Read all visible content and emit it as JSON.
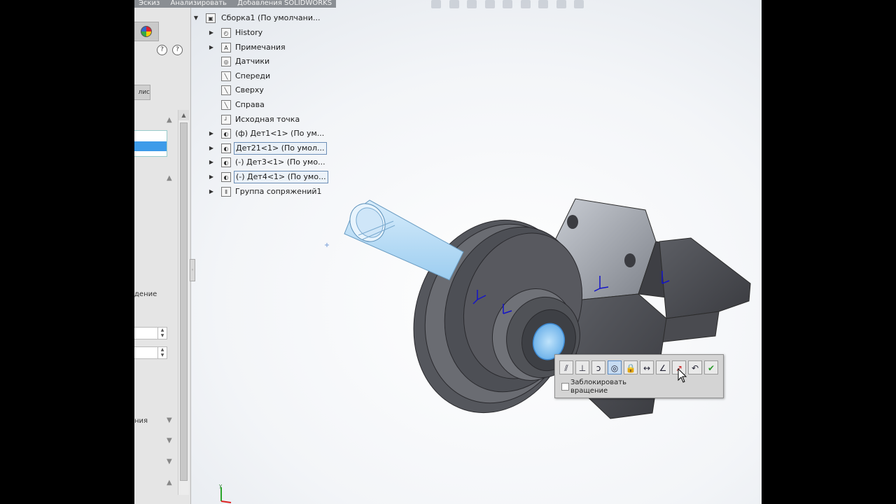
{
  "menu": {
    "items": [
      "Эскиз",
      "Анализировать",
      "Добавления SOLIDWORKS"
    ]
  },
  "left_panel": {
    "help_labels": [
      "?",
      "?"
    ],
    "partial_button": "лис",
    "partial_text_1": "дение",
    "partial_text_2": "ния"
  },
  "tree": {
    "root": "Сборка1  (По умолчани...",
    "nodes": [
      {
        "label": "History",
        "icon": "history-icon",
        "expandable": true,
        "boxed": false
      },
      {
        "label": "Примечания",
        "icon": "annotations-icon",
        "expandable": true,
        "boxed": false
      },
      {
        "label": "Датчики",
        "icon": "sensors-icon",
        "expandable": false,
        "boxed": false
      },
      {
        "label": "Спереди",
        "icon": "plane-icon",
        "expandable": false,
        "boxed": false
      },
      {
        "label": "Сверху",
        "icon": "plane-icon",
        "expandable": false,
        "boxed": false
      },
      {
        "label": "Справа",
        "icon": "plane-icon",
        "expandable": false,
        "boxed": false
      },
      {
        "label": "Исходная точка",
        "icon": "origin-icon",
        "expandable": false,
        "boxed": false
      },
      {
        "label": "(ф) Дет1<1> (По ум...",
        "icon": "part-icon",
        "expandable": true,
        "boxed": false
      },
      {
        "label": "Дет21<1> (По умол...",
        "icon": "part-icon",
        "expandable": true,
        "boxed": true
      },
      {
        "label": "(-) Дет3<1> (По умо...",
        "icon": "part-icon",
        "expandable": true,
        "boxed": false
      },
      {
        "label": "(-) Дет4<1> (По умо...",
        "icon": "part-icon",
        "expandable": true,
        "boxed": true
      },
      {
        "label": "Группа сопряжений1",
        "icon": "mates-icon",
        "expandable": true,
        "boxed": false
      }
    ]
  },
  "context_toolbar": {
    "buttons": [
      "coincident-icon",
      "perpendicular-icon",
      "tangent-icon",
      "concentric-icon",
      "lock-icon",
      "distance-icon",
      "angle-icon",
      "rotate-mate-icon",
      "undo-icon",
      "ok-icon"
    ],
    "active_index": 3,
    "lock_rotation_label": "Заблокировать вращение",
    "lock_rotation_checked": false
  },
  "colors": {
    "selection": "#3d9be9",
    "part": "#4f5157",
    "highlight": "#8cc8f4"
  }
}
